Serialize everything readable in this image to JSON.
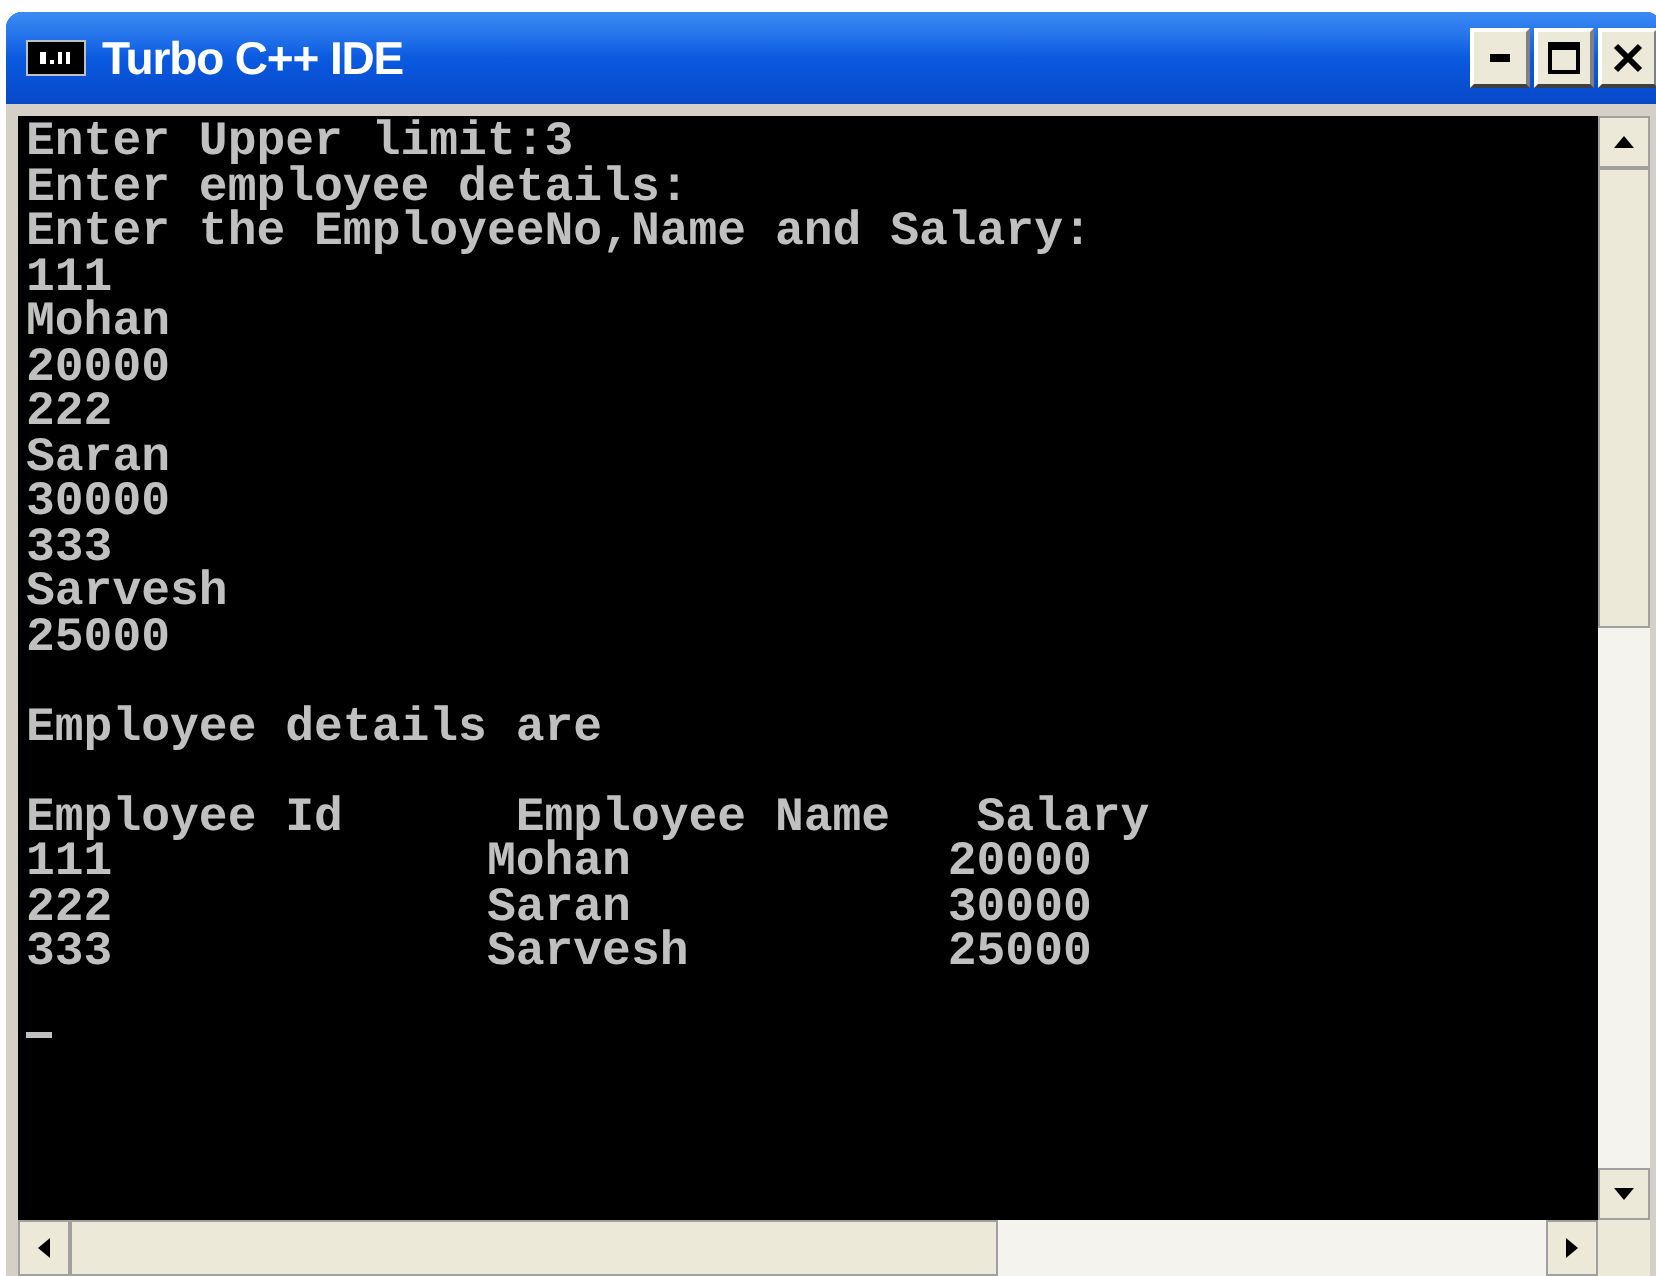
{
  "window": {
    "title": "Turbo C++ IDE"
  },
  "console": {
    "lines": [
      "Enter Upper limit:3",
      "Enter employee details:",
      "Enter the EmployeeNo,Name and Salary:",
      "111",
      "Mohan",
      "20000",
      "222",
      "Saran",
      "30000",
      "333",
      "Sarvesh",
      "25000"
    ],
    "summary": "Employee details are",
    "table": {
      "columns": [
        "Employee Id",
        "Employee Name",
        "Salary"
      ],
      "rows": [
        [
          "111",
          "Mohan",
          "20000"
        ],
        [
          "222",
          "Saran",
          "30000"
        ],
        [
          "333",
          "Sarvesh",
          "25000"
        ]
      ]
    }
  }
}
